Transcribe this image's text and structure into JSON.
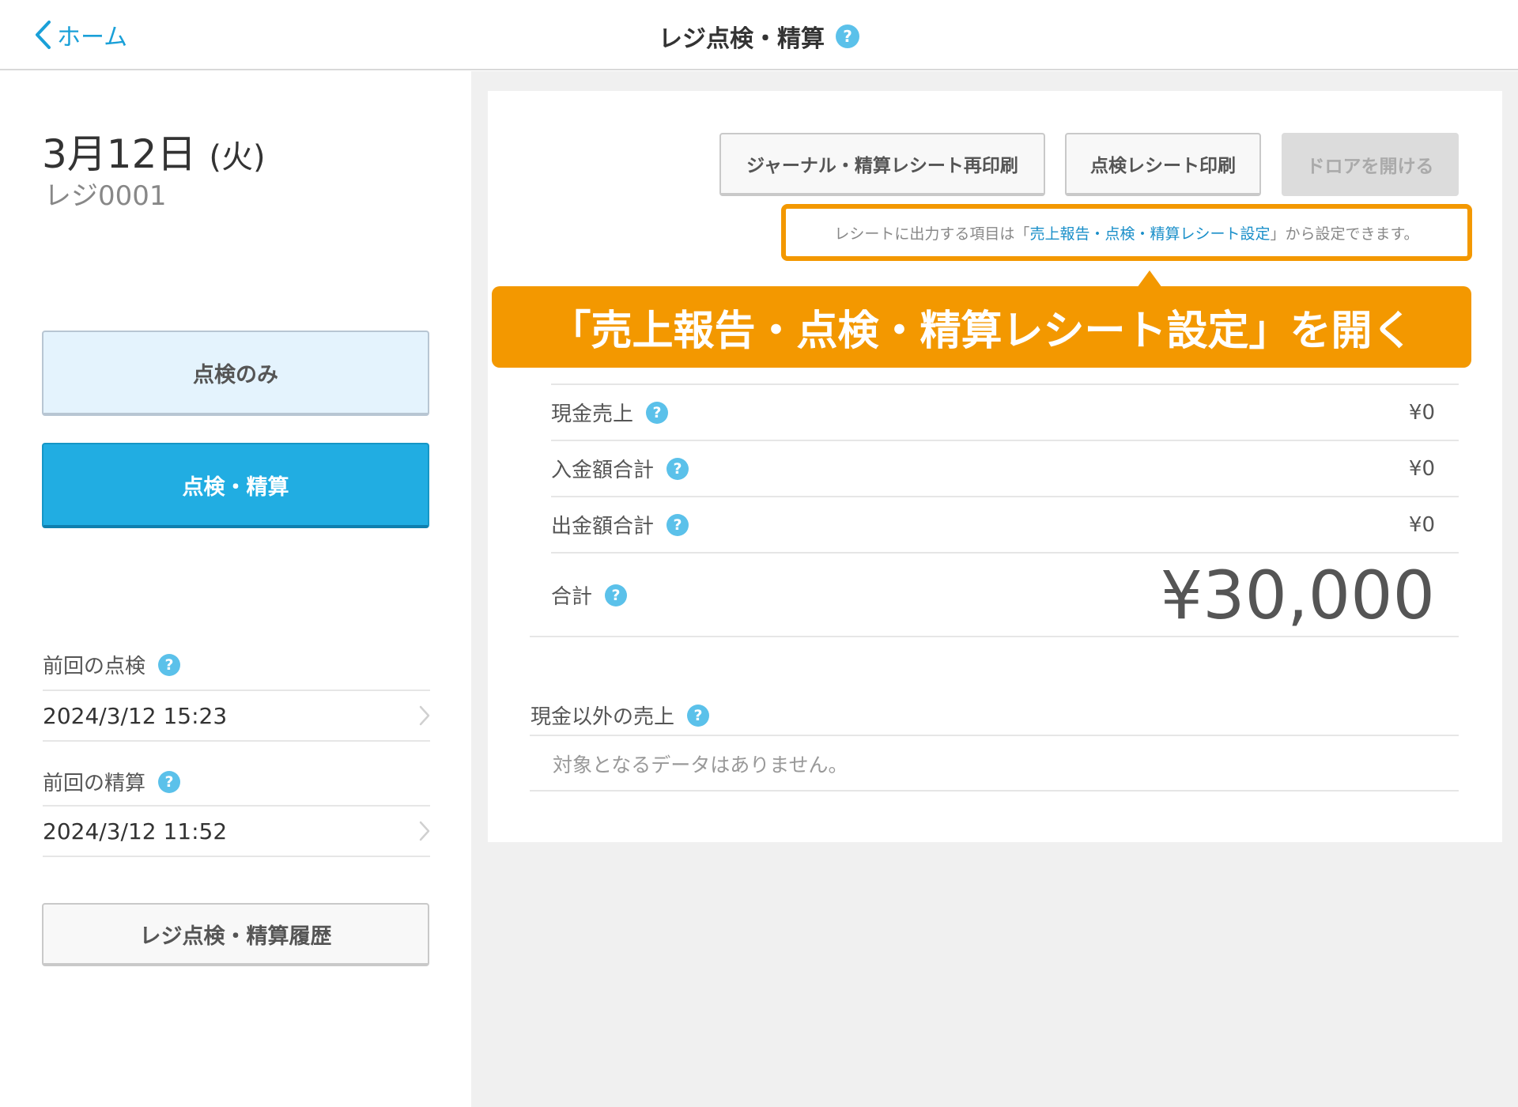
{
  "header": {
    "back_label": "ホーム",
    "title": "レジ点検・精算"
  },
  "left": {
    "date_month_day": "3月12日",
    "date_weekday": "(火)",
    "register": "レジ0001",
    "btn_check_only": "点検のみ",
    "btn_check_settle": "点検・精算",
    "last_check_label": "前回の点検",
    "last_check_value": "2024/3/12 15:23",
    "last_settle_label": "前回の精算",
    "last_settle_value": "2024/3/12 11:52",
    "btn_history": "レジ点検・精算履歴"
  },
  "toolbar": {
    "reprint": "ジャーナル・精算レシート再印刷",
    "print_check": "点検レシート印刷",
    "open_drawer": "ドロアを開ける"
  },
  "note": {
    "prefix": "レシートに出力する項目は「",
    "link": "売上報告・点検・精算レシート設定",
    "suffix": "」から設定できます。"
  },
  "callout": "「売上報告・点検・精算レシート設定」を開く",
  "summary": {
    "cash_sales_label": "現金売上",
    "cash_sales_value": "¥0",
    "deposit_label": "入金額合計",
    "deposit_value": "¥0",
    "withdraw_label": "出金額合計",
    "withdraw_value": "¥0",
    "total_label": "合計",
    "total_value": "¥30,000"
  },
  "other": {
    "label": "現金以外の売上",
    "empty": "対象となるデータはありません。"
  },
  "colors": {
    "accent": "#21ade2",
    "link": "#1aa0d8",
    "highlight": "#f39800",
    "help_icon": "#5bc1ea"
  },
  "icons": {
    "back": "chevron-left-icon",
    "help": "question-circle-icon",
    "row_arrow": "chevron-right-icon"
  }
}
